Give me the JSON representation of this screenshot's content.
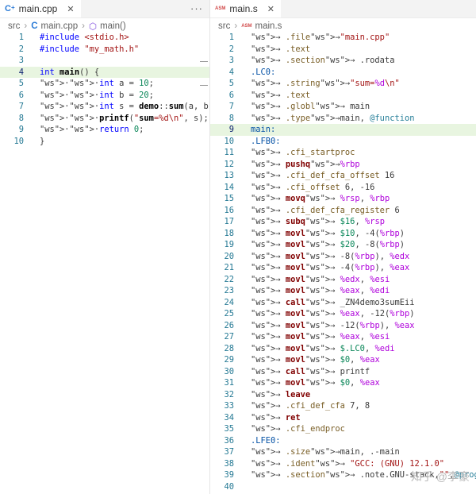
{
  "left": {
    "tab": {
      "icon": "cpp-file-icon",
      "label": "main.cpp"
    },
    "tab_actions": "···",
    "breadcrumb": [
      "src",
      "main.cpp",
      "main()"
    ]
  },
  "right": {
    "tab": {
      "icon": "asm-file-icon",
      "badge": "ASM",
      "label": "main.s"
    },
    "breadcrumb": [
      "src",
      "main.s"
    ],
    "badge": "ASM"
  },
  "left_lines": [
    "#include <stdio.h>",
    "#include \"my_math.h\"",
    "",
    "int main() {",
    "··int a = 10;",
    "··int b = 20;",
    "··int s = demo::sum(a, b);",
    "··printf(\"sum=%d\\n\", s);",
    "··return 0;",
    "}"
  ],
  "right_lines": [
    "→ .file→\"main.cpp\"",
    "→ .text",
    "→ .section→ .rodata",
    ".LC0:",
    "→ .string→\"sum=%d\\n\"",
    "→ .text",
    "→ .globl→ main",
    "→ .type→main, @function",
    "main:",
    ".LFB0:",
    "→ .cfi_startproc",
    "→ pushq→%rbp",
    "→ .cfi_def_cfa_offset 16",
    "→ .cfi_offset 6, -16",
    "→ movq→ %rsp, %rbp",
    "→ .cfi_def_cfa_register 6",
    "→ subq→ $16, %rsp",
    "→ movl→ $10, -4(%rbp)",
    "→ movl→ $20, -8(%rbp)",
    "→ movl→ -8(%rbp), %edx",
    "→ movl→ -4(%rbp), %eax",
    "→ movl→ %edx, %esi",
    "→ movl→ %eax, %edi",
    "→ call→ _ZN4demo3sumEii",
    "→ movl→ %eax, -12(%rbp)",
    "→ movl→ -12(%rbp), %eax",
    "→ movl→ %eax, %esi",
    "→ movl→ $.LC0, %edi",
    "→ movl→ $0, %eax",
    "→ call→ printf",
    "→ movl→ $0, %eax",
    "→ leave",
    "→ .cfi_def_cfa 7, 8",
    "→ ret",
    "→ .cfi_endproc",
    ".LFE0:",
    "→ .size→main, .-main",
    "→ .ident→ \"GCC: (GNU) 12.1.0\"",
    "→ .section→ .note.GNU-stack,\"\",@progbits",
    ""
  ],
  "left_current_line": 4,
  "right_current_line": 9,
  "watermark": "知乎 @李豪"
}
